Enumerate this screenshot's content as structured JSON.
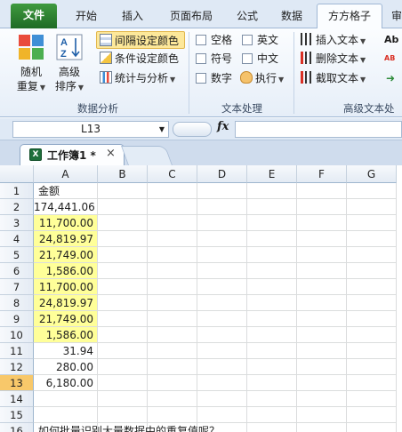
{
  "ribbon_tabs": [
    {
      "label": "文件"
    },
    {
      "label": "开始"
    },
    {
      "label": "插入"
    },
    {
      "label": "页面布局"
    },
    {
      "label": "公式"
    },
    {
      "label": "数据"
    },
    {
      "label": "方方格子"
    },
    {
      "label": "审"
    }
  ],
  "groups": {
    "data_analysis": {
      "label": "数据分析",
      "random_repeat": {
        "line1": "随机",
        "line2": "重复"
      },
      "advanced_sort": {
        "line1": "高级",
        "line2": "排序"
      },
      "interval_color": "间隔设定颜色",
      "condition_color": "条件设定颜色",
      "stats_analysis": "统计与分析"
    },
    "text_processing": {
      "label": "文本处理",
      "space": "空格",
      "english": "英文",
      "symbol": "符号",
      "chinese": "中文",
      "digit": "数字",
      "execute": "执行"
    },
    "advanced_text": {
      "label": "高级文本处",
      "insert_text": "插入文本",
      "delete_text": "删除文本",
      "extract_text": "截取文本",
      "ab1": "Ab",
      "ab2": "AB"
    }
  },
  "colors": {
    "file_tab": "#2a7b2e",
    "highlight_button": "#fde89a",
    "yellow_fill": "#ffff99",
    "selected_header": "#f8c86a"
  },
  "formula_bar": {
    "name_box": "L13",
    "fx_label": "fx",
    "formula": ""
  },
  "workbook_tab": {
    "title": "工作簿1 *",
    "close": "×"
  },
  "sheet": {
    "columns": [
      "A",
      "B",
      "C",
      "D",
      "E",
      "F",
      "G"
    ],
    "rows": [
      {
        "n": "1",
        "a": "金额",
        "yellow": false,
        "type": "txt"
      },
      {
        "n": "2",
        "a": "174,441.06",
        "yellow": false,
        "type": "num"
      },
      {
        "n": "3",
        "a": "11,700.00",
        "yellow": true,
        "type": "num"
      },
      {
        "n": "4",
        "a": "24,819.97",
        "yellow": true,
        "type": "num"
      },
      {
        "n": "5",
        "a": "21,749.00",
        "yellow": true,
        "type": "num"
      },
      {
        "n": "6",
        "a": "1,586.00",
        "yellow": true,
        "type": "num"
      },
      {
        "n": "7",
        "a": "11,700.00",
        "yellow": true,
        "type": "num"
      },
      {
        "n": "8",
        "a": "24,819.97",
        "yellow": true,
        "type": "num"
      },
      {
        "n": "9",
        "a": "21,749.00",
        "yellow": true,
        "type": "num"
      },
      {
        "n": "10",
        "a": "1,586.00",
        "yellow": true,
        "type": "num"
      },
      {
        "n": "11",
        "a": "31.94",
        "yellow": false,
        "type": "num"
      },
      {
        "n": "12",
        "a": "280.00",
        "yellow": false,
        "type": "num"
      },
      {
        "n": "13",
        "a": "6,180.00",
        "yellow": false,
        "type": "num"
      },
      {
        "n": "14",
        "a": "",
        "yellow": false,
        "type": "num"
      },
      {
        "n": "15",
        "a": "",
        "yellow": false,
        "type": "num"
      },
      {
        "n": "16",
        "a": "如何批量识别大量数据中的重复值呢？",
        "yellow": false,
        "type": "txt"
      }
    ]
  }
}
